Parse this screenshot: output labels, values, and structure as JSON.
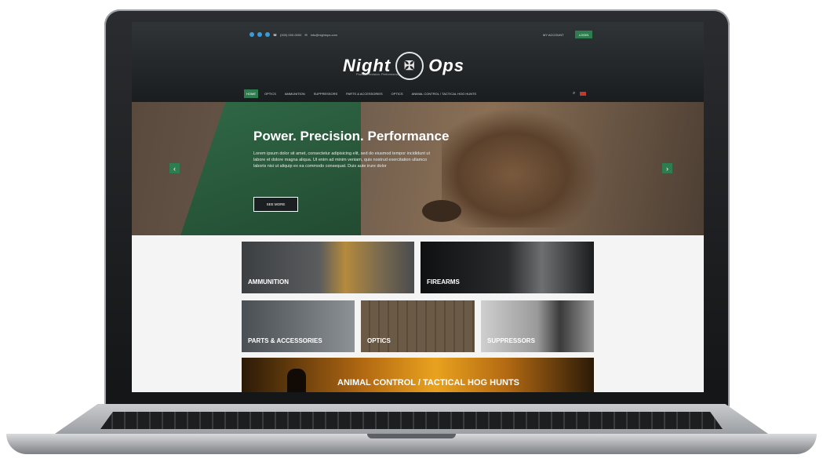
{
  "header": {
    "phone": "(000) 000-0000",
    "email": "info@nightops.com",
    "account_label": "MY ACCOUNT",
    "login_label": "LOGIN",
    "logo_left": "Night",
    "logo_right": "Ops",
    "tagline": "Power. Precision. Performance"
  },
  "nav": {
    "items": [
      "HOME",
      "OPTICS",
      "AMMUNITION",
      "SUPPRESSORS",
      "PARTS & ACCESSORIES",
      "OPTICS",
      "ANIMAL CONTROL / TACTICAL HOG HUNTS"
    ]
  },
  "hero": {
    "title": "Power. Precision. Performance",
    "text": "Lorem ipsum dolor sit amet, consectetur adipisicing elit, sed do eiusmod tempor incididunt ut labore et dolore magna aliqua. Ut enim ad minim veniam, quis nostrud exercitation ullamco laboris nisi ut aliquip ex ea commodo consequat. Duis aute irure dolor",
    "button": "SEE MORE",
    "prev_glyph": "‹",
    "next_glyph": "›"
  },
  "tiles": {
    "ammunition": "AMMUNITION",
    "firearms": "FIREARMS",
    "parts": "PARTS & ACCESSORIES",
    "optics": "OPTICS",
    "suppressors": "SUPPRESSORS",
    "animal": "ANIMAL CONTROL / TACTICAL HOG HUNTS"
  },
  "colors": {
    "accent_green": "#2e7d4f",
    "header_dark": "#1a1d1f"
  }
}
